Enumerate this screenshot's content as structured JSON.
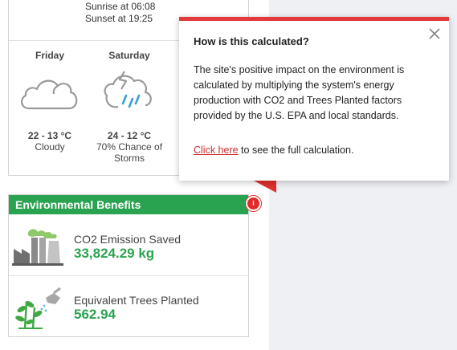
{
  "weather": {
    "sunrise": "Sunrise at 06:08",
    "sunset": "Sunset at 19:25",
    "days": [
      {
        "name": "Friday",
        "temp": "22 - 13 °C",
        "condition": "Cloudy",
        "icon": "cloud-icon"
      },
      {
        "name": "Saturday",
        "temp": "24 - 12 °C",
        "condition": "70% Chance of Storms",
        "icon": "storm-icon"
      }
    ]
  },
  "environmental": {
    "title": "Environmental Benefits",
    "co2": {
      "label": "CO2 Emission Saved",
      "value": "33,824.29 kg",
      "icon": "factory-icon"
    },
    "trees": {
      "label": "Equivalent Trees Planted",
      "value": "562.94",
      "icon": "plant-watering-icon"
    }
  },
  "info_button": {
    "icon": "info-icon",
    "glyph": "i"
  },
  "popover": {
    "title": "How is this calculated?",
    "body": "The site's positive impact on the environment is calculated by multiplying the system's energy production with CO2 and Trees Planted factors provided by the U.S. EPA and local standards.",
    "link_text": "Click here",
    "footer_rest": " to see the full calculation.",
    "close_icon": "close-icon"
  },
  "colors": {
    "accent_green": "#2aa350",
    "accent_red": "#e23a3a",
    "background_right": "#eef0f4"
  }
}
